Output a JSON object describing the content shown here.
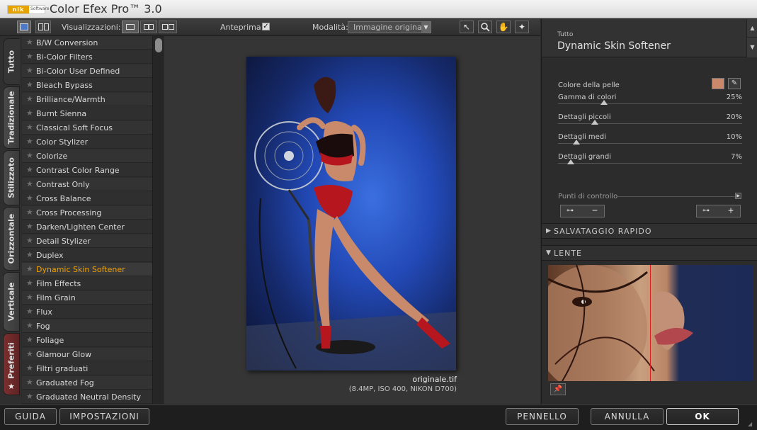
{
  "window": {
    "title": "Color Efex Pro™ 3.0",
    "logo_text": "nik",
    "logo_sub": "Software"
  },
  "toolbar": {
    "views_label": "Visualizzazioni:",
    "preview_label": "Anteprima:",
    "preview_checked": "✓",
    "mode_label": "Modalità:",
    "mode_value": "Immagine originale",
    "tools": [
      "pointer-icon",
      "zoom-icon",
      "hand-icon",
      "light-icon"
    ]
  },
  "tabs": [
    {
      "label": "Tutto"
    },
    {
      "label": "Tradizionale"
    },
    {
      "label": "Stilizzato"
    },
    {
      "label": "Orizzontale"
    },
    {
      "label": "Verticale"
    },
    {
      "label": "Preferiti"
    }
  ],
  "filters": [
    "B/W Conversion",
    "Bi-Color Filters",
    "Bi-Color User Defined",
    "Bleach Bypass",
    "Brilliance/Warmth",
    "Burnt Sienna",
    "Classical Soft Focus",
    "Color Stylizer",
    "Colorize",
    "Contrast Color Range",
    "Contrast Only",
    "Cross Balance",
    "Cross Processing",
    "Darken/Lighten Center",
    "Detail Stylizer",
    "Duplex",
    "Dynamic Skin Softener",
    "Film Effects",
    "Film Grain",
    "Flux",
    "Fog",
    "Foliage",
    "Glamour Glow",
    "Filtri graduati",
    "Graduated Fog",
    "Graduated Neutral Density"
  ],
  "selected_filter_index": 16,
  "preview": {
    "file_name": "originale.tif",
    "file_meta": "(8.4MP, ISO 400, NIKON D700)"
  },
  "panel": {
    "category": "Tutto",
    "filter_name": "Dynamic Skin Softener",
    "skin_color_label": "Colore della pelle",
    "skin_color": "#c9896a",
    "sliders": [
      {
        "label": "Gamma di colori",
        "value": "25%",
        "level": 0.25
      },
      {
        "label": "Dettagli piccoli",
        "value": "20%",
        "level": 0.2
      },
      {
        "label": "Dettagli medi",
        "value": "10%",
        "level": 0.1
      },
      {
        "label": "Dettagli grandi",
        "value": "7%",
        "level": 0.07
      }
    ],
    "control_points_label": "Punti di controllo",
    "remove_cp_symbol": "−",
    "add_cp_symbol": "+",
    "quick_save_label": "SALVATAGGIO RAPIDO",
    "loupe_label": "LENTE"
  },
  "bottom": {
    "help": "GUIDA",
    "settings": "IMPOSTAZIONI",
    "brush": "PENNELLO",
    "cancel": "ANNULLA",
    "ok": "OK"
  },
  "colors": {
    "accent_selected": "#f0a000",
    "background": "#2b2b2b"
  }
}
